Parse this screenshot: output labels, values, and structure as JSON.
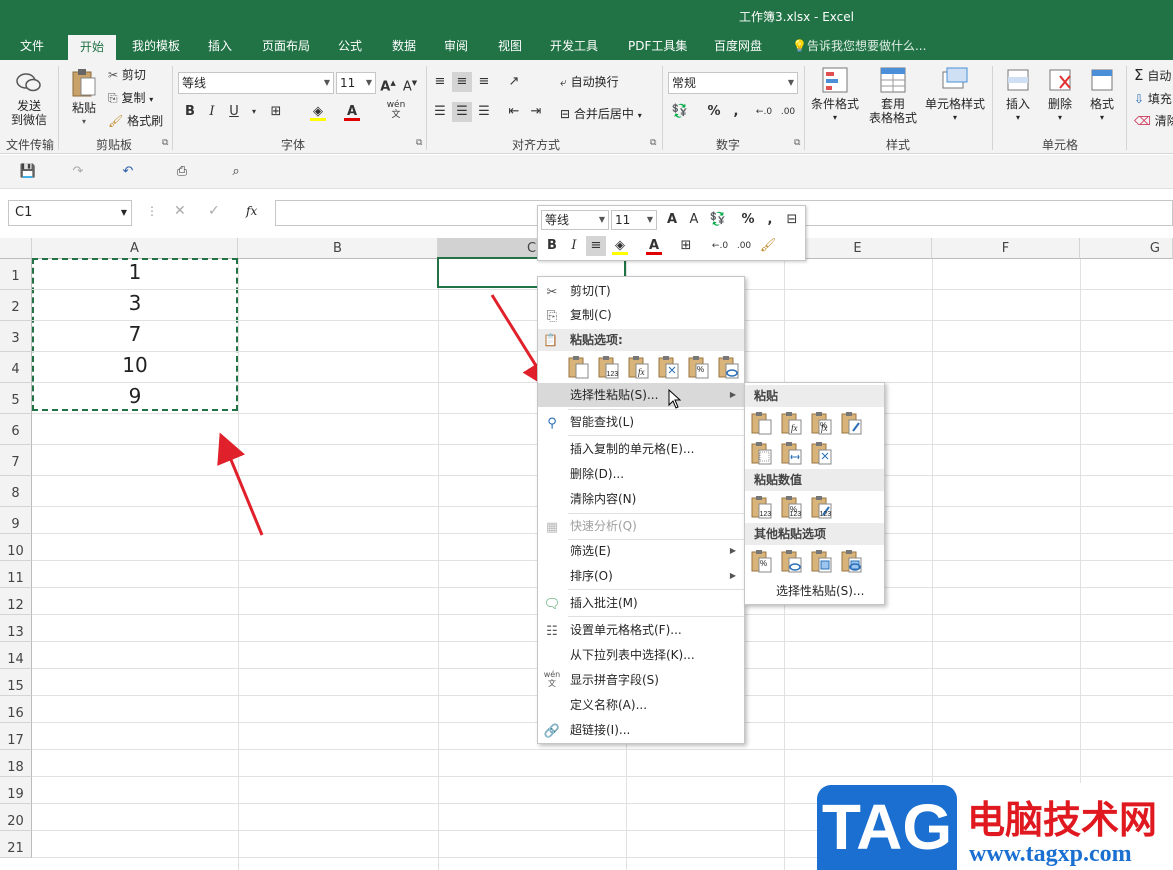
{
  "window": {
    "title": "工作簿3.xlsx - Excel"
  },
  "tabs": [
    "文件",
    "开始",
    "我的模板",
    "插入",
    "页面布局",
    "公式",
    "数据",
    "审阅",
    "视图",
    "开发工具",
    "PDF工具集",
    "百度网盘"
  ],
  "tell_me": "告诉我您想要做什么...",
  "ribbon": {
    "send_wechat": "发送\n到微信",
    "file_transfer_group": "文件传输",
    "paste": "粘贴",
    "cut": "剪切",
    "copy": "复制",
    "format_painter": "格式刷",
    "clipboard_group": "剪贴板",
    "font_name": "等线",
    "font_size": "11",
    "font_group": "字体",
    "wrap_text": "自动换行",
    "merge_center": "合并后居中",
    "alignment_group": "对齐方式",
    "number_format": "常规",
    "number_group": "数字",
    "conditional_format": "条件格式",
    "table_format": "套用\n表格格式",
    "cell_styles": "单元格样式",
    "styles_group": "样式",
    "insert": "插入",
    "delete": "删除",
    "format": "格式",
    "cells_group": "单元格",
    "autosum": "自动",
    "fill": "填充",
    "clear": "清除"
  },
  "formula_bar": {
    "name_box": "C1",
    "fx": "fx",
    "formula": ""
  },
  "sheet": {
    "columns": [
      "A",
      "B",
      "C",
      "D",
      "E",
      "F",
      "G"
    ],
    "rows": [
      "1",
      "2",
      "3",
      "4",
      "5",
      "6",
      "7",
      "8",
      "9",
      "10",
      "11",
      "12",
      "13",
      "14",
      "15",
      "16",
      "17",
      "18",
      "19",
      "20",
      "21"
    ],
    "column_a_values": [
      "1",
      "3",
      "7",
      "10",
      "9"
    ]
  },
  "mini_toolbar": {
    "font_name": "等线",
    "font_size": "11"
  },
  "context_menu": {
    "cut": "剪切(T)",
    "copy": "复制(C)",
    "paste_options": "粘贴选项:",
    "paste_special": "选择性粘贴(S)...",
    "smart_lookup": "智能查找(L)",
    "insert_copied": "插入复制的单元格(E)...",
    "delete": "删除(D)...",
    "clear_contents": "清除内容(N)",
    "quick_analysis": "快速分析(Q)",
    "filter": "筛选(E)",
    "sort": "排序(O)",
    "insert_comment": "插入批注(M)",
    "format_cells": "设置单元格格式(F)...",
    "pick_from_list": "从下拉列表中选择(K)...",
    "show_phonetic": "显示拼音字段(S)",
    "define_name": "定义名称(A)...",
    "hyperlink": "超链接(I)..."
  },
  "submenu": {
    "paste": "粘贴",
    "paste_values": "粘贴数值",
    "other_paste": "其他粘贴选项",
    "paste_special": "选择性粘贴(S)..."
  },
  "watermark": {
    "brand": "TAG",
    "site_cn": "电脑技术网",
    "url": "www.tagxp.com"
  },
  "colors": {
    "excel_green": "#217346",
    "arrow_red": "#e0202a",
    "logo_blue": "#1b6fd0",
    "logo_red": "#e0181f"
  }
}
